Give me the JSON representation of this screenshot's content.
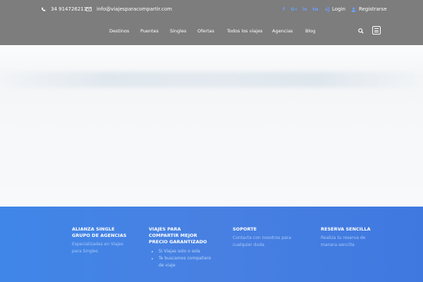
{
  "topbar": {
    "phone": "34 914726211",
    "email": "info@viajesparacompartir.com",
    "socials": [
      "f",
      "G+",
      "in",
      "tw"
    ],
    "login": "Login",
    "register": "Registrarse"
  },
  "nav": {
    "items": [
      "Destinos",
      "Puentes",
      "Singles",
      "Ofertas",
      "Todos los viajes",
      "Agencias",
      "Blog"
    ]
  },
  "footer": {
    "col1": {
      "title": "ALIANZA SINGLE GRUPO DE AGENCIAS",
      "text": "Especializadas en Viajes para Singles"
    },
    "col2": {
      "title": "VIAJES PARA COMPARTIR MEJOR PRECIO GARANTIZADO",
      "items": [
        "Si Viajas solo o sola",
        "Te buscamos compañero de viaje"
      ]
    },
    "col3": {
      "title": "SOPORTE",
      "text": "Contacta con nosotros para cualquier duda"
    },
    "col4": {
      "title": "RESERVA SENCILLA",
      "text": "Realiza tu reserva de manera sencilla"
    }
  },
  "colors": {
    "header": "#7d7d7d",
    "footer": "#4880e2",
    "accent": "#6aa0ff"
  }
}
